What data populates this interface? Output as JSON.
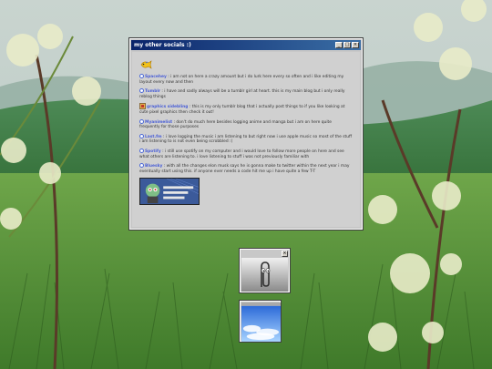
{
  "window": {
    "title": "my other socials :)",
    "controls": {
      "minimize": "_",
      "maximize": "□",
      "close": "×"
    }
  },
  "entries": [
    {
      "name": "Spacehey",
      "text": " : i am not on here a crazy amount but i do lurk here every so often and i like editing my layout every now and then"
    },
    {
      "name": "Tumblr",
      "text": " : i have and sadly always will be a tumblr girl at heart. this is my main blog but i only really reblog things"
    },
    {
      "name": "graphics sidebling",
      "text": " : this is my only tumblr blog that i actually post things to if you like looking at cute pixel graphics then check it out!"
    },
    {
      "name": "Myanimelist",
      "text": " : don't do much here besides logging anime and manga but i am on here quite frequently for those purposes"
    },
    {
      "name": "Last.fm",
      "text": " : i love logging the music i am listening to but right now i use apple music so most of the stuff i am listening to is not even being scrobbled :("
    },
    {
      "name": "Spotify",
      "text": " : i still use spotify on my computer and i would love to follow more people on here and see what others are listening to. i love listening to stuff i was not previously familiar with"
    },
    {
      "name": "Bluesky",
      "text": " : with all the changes elon musk says he is gonna make to twitter within the next year i may eventually start using this. if anyone ever needs a code hit me up i have quite a few T-T"
    }
  ],
  "mini_windows": [
    {
      "close": "×"
    }
  ],
  "colors": {
    "accent": "#4a5fd6",
    "titlebar": "#0a246a",
    "window_bg": "#d0d0d0"
  },
  "icons": [
    "goldfish-icon",
    "graphics-icon",
    "bullet-icon",
    "paperclip-icon"
  ]
}
